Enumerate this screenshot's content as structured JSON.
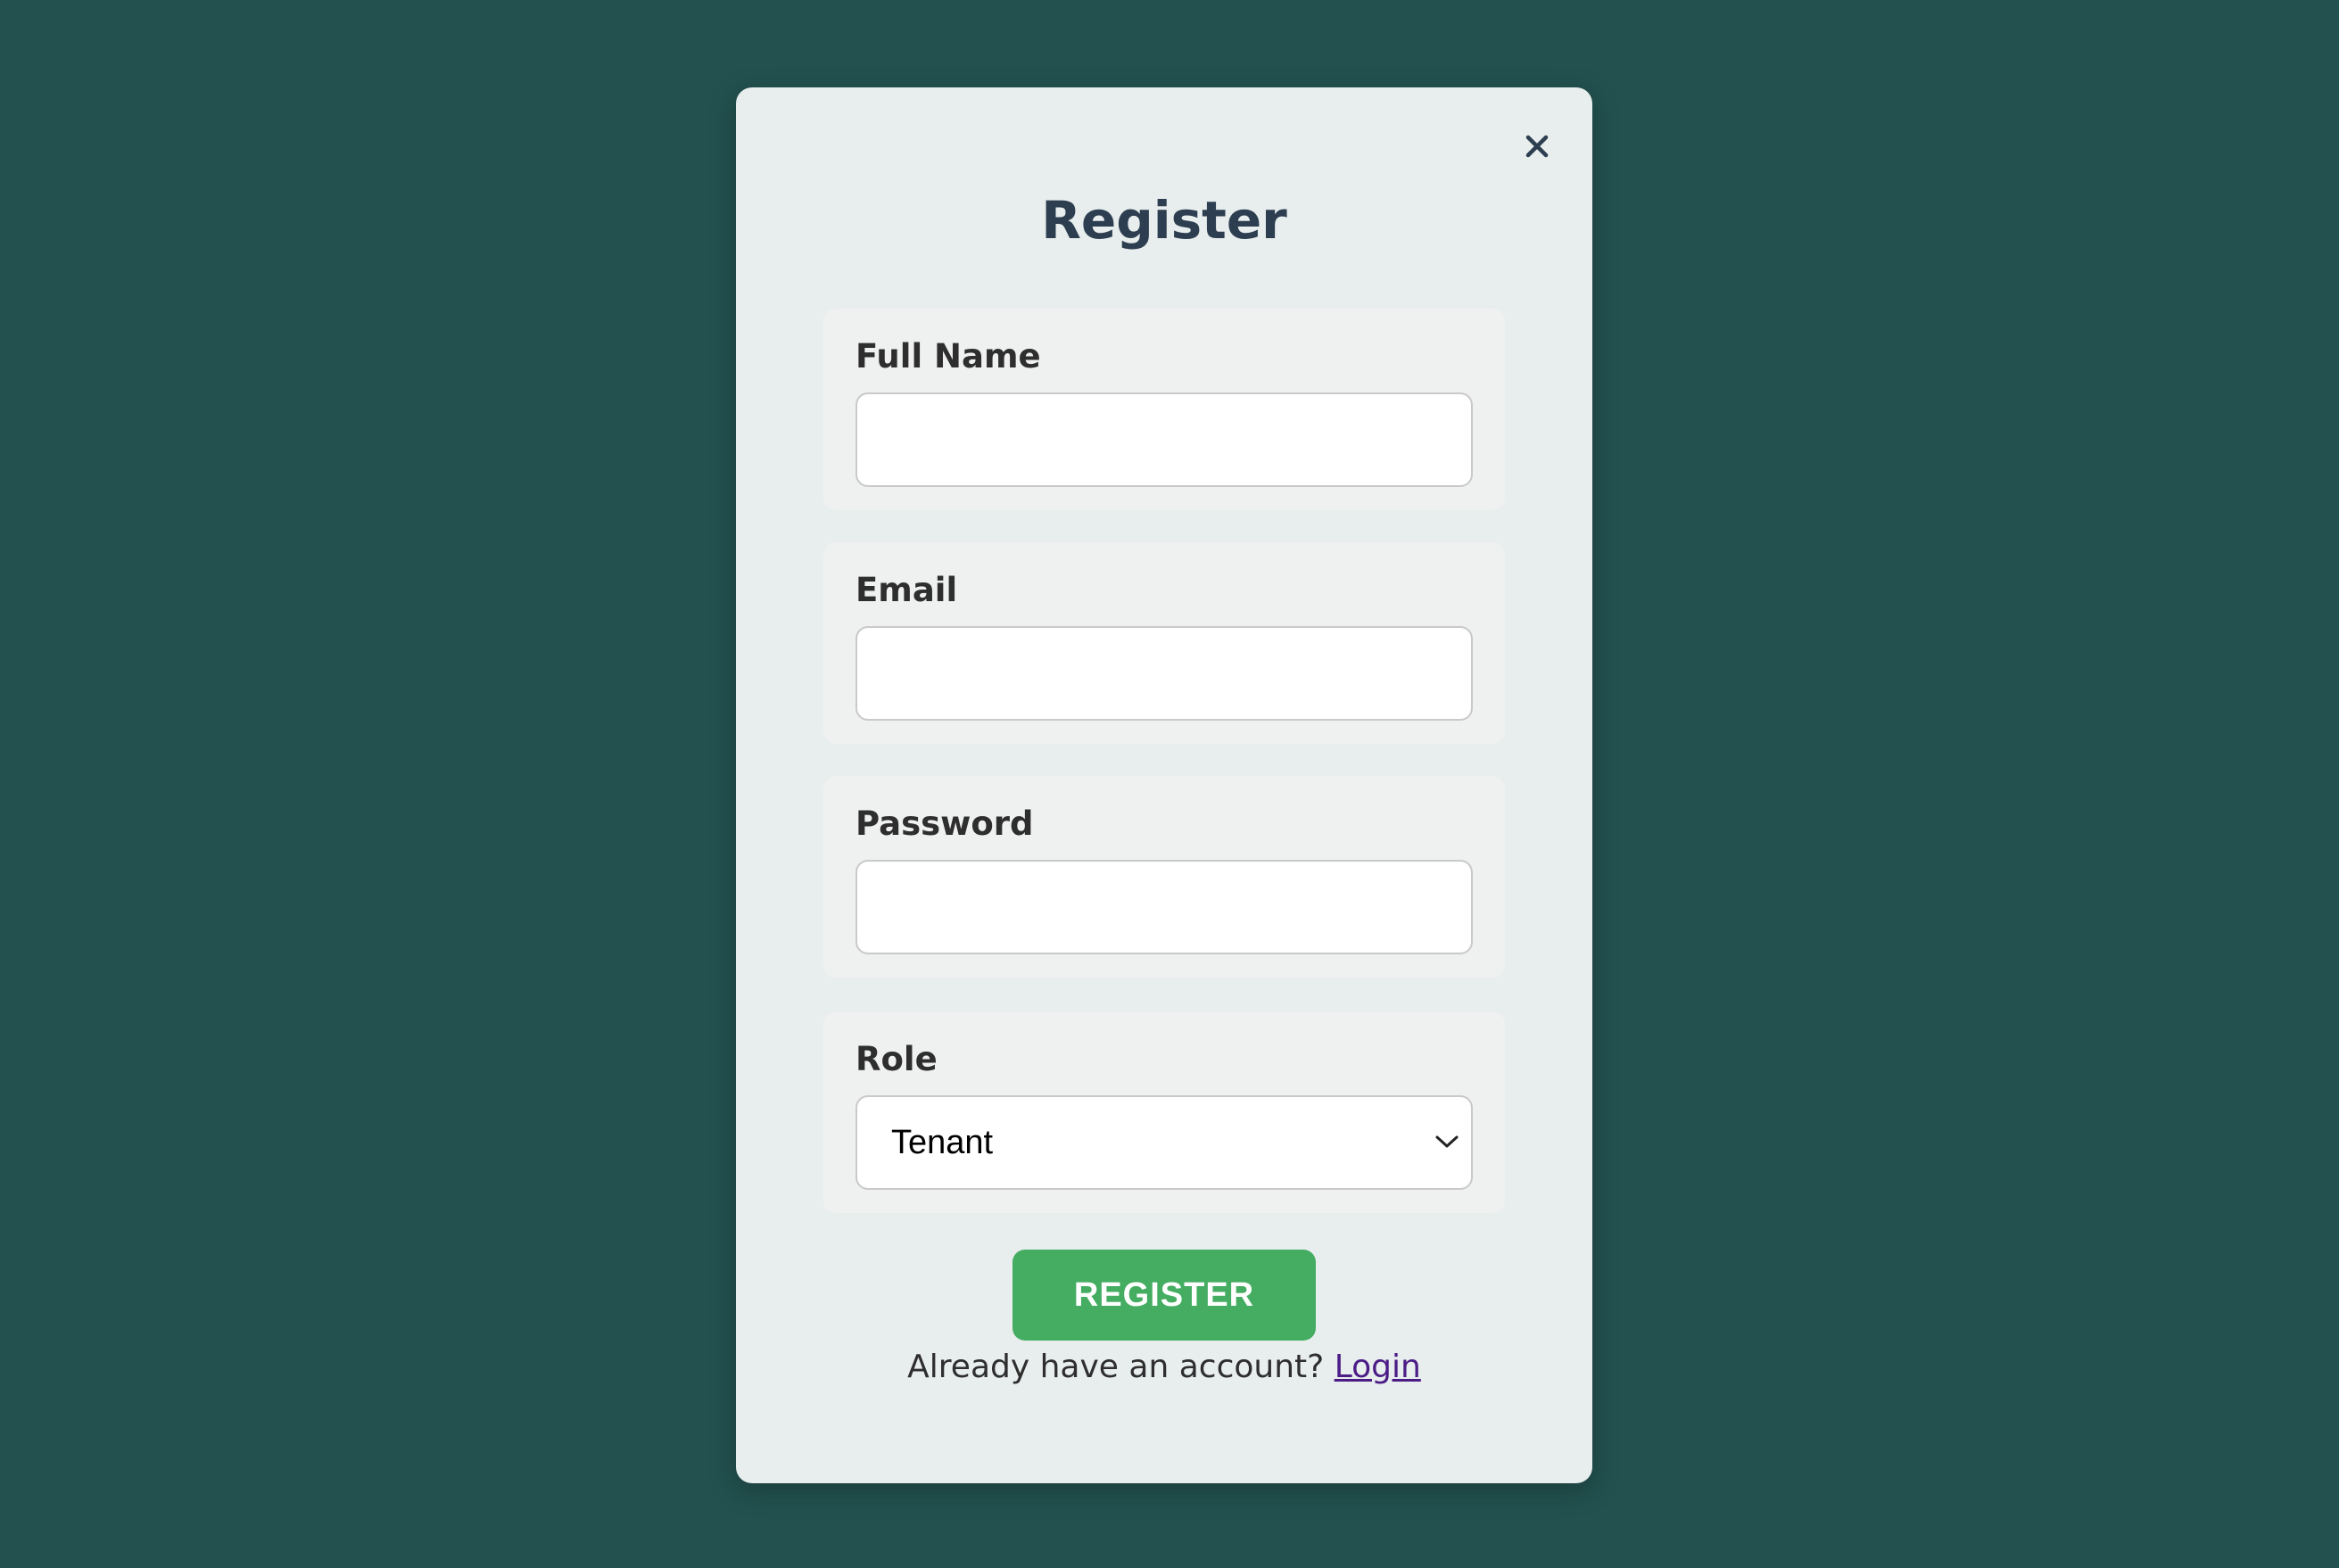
{
  "colors": {
    "background": "#22514f",
    "modal": "#e8eded",
    "accent": "#44ad62",
    "link": "#4b1c86",
    "title": "#2c3e50"
  },
  "modal": {
    "title": "Register",
    "close_icon": "close-icon"
  },
  "form": {
    "full_name": {
      "label": "Full Name",
      "value": "",
      "placeholder": ""
    },
    "email": {
      "label": "Email",
      "value": "",
      "placeholder": ""
    },
    "password": {
      "label": "Password",
      "value": "",
      "placeholder": ""
    },
    "role": {
      "label": "Role",
      "selected": "Tenant",
      "icon": "chevron-down-icon"
    }
  },
  "actions": {
    "register_label": "REGISTER"
  },
  "footer": {
    "prompt": "Already have an account? ",
    "login_label": "Login"
  }
}
